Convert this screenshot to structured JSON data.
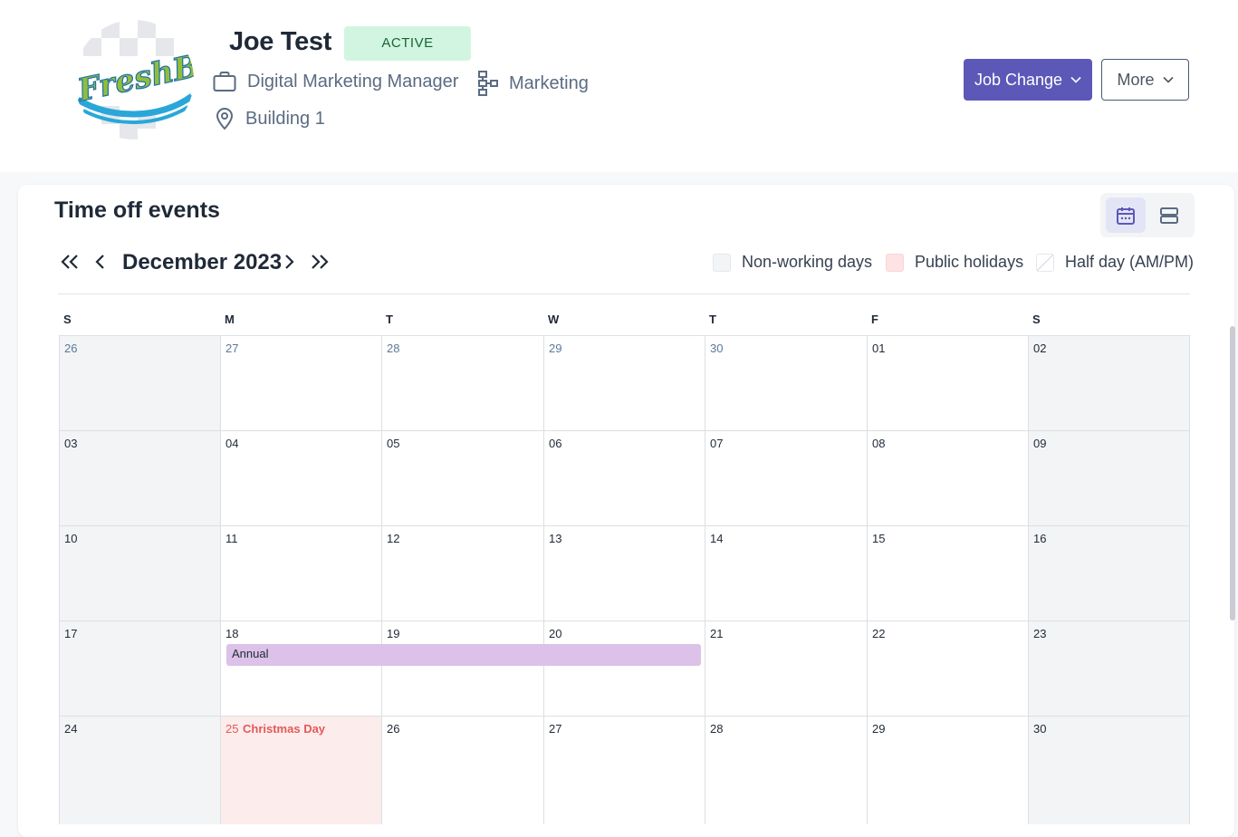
{
  "profile": {
    "name": "Joe Test",
    "status": "ACTIVE",
    "job_title": "Digital Marketing Manager",
    "department": "Marketing",
    "location": "Building 1",
    "avatar_icon": "freshbooks-logo-avatar",
    "avatar_logo_text": "FreshBo"
  },
  "actions": {
    "job_change_label": "Job Change",
    "more_label": "More"
  },
  "calendar": {
    "title": "Time off events",
    "month_label": "December 2023",
    "legend": [
      {
        "label": "Non-working days",
        "color": "#f3f4f6"
      },
      {
        "label": "Public holidays",
        "color": "#fde3e3"
      },
      {
        "label": "Half day (AM/PM)",
        "color": "#ffffff"
      }
    ],
    "weekdays": [
      "S",
      "M",
      "T",
      "W",
      "T",
      "F",
      "S"
    ],
    "weeks": [
      [
        "26",
        "27",
        "28",
        "29",
        "30",
        "01",
        "02"
      ],
      [
        "03",
        "04",
        "05",
        "06",
        "07",
        "08",
        "09"
      ],
      [
        "10",
        "11",
        "12",
        "13",
        "14",
        "15",
        "16"
      ],
      [
        "17",
        "18",
        "19",
        "20",
        "21",
        "22",
        "23"
      ],
      [
        "24",
        "25",
        "26",
        "27",
        "28",
        "29",
        "30"
      ]
    ],
    "holiday_name": "Christmas Day",
    "event_label": "Annual"
  },
  "colors": {
    "accent": "#5c58b8",
    "status_bg": "#d1f5e1",
    "event": "#dcc1e8",
    "holiday_text": "#e25a5a"
  }
}
